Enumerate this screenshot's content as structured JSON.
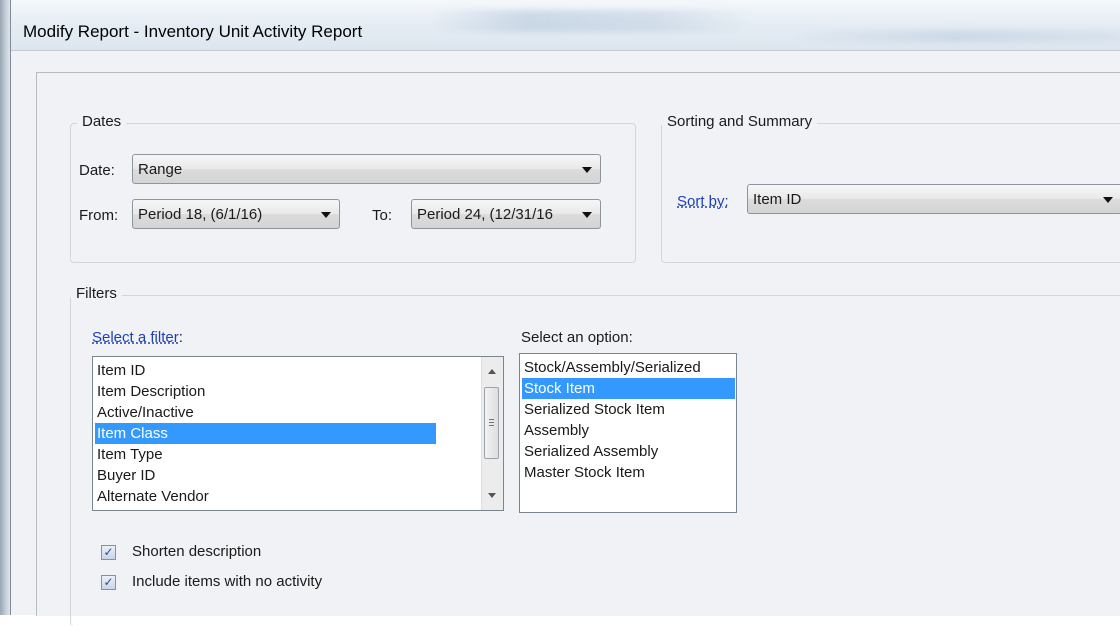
{
  "window": {
    "title": "Modify Report - Inventory Unit Activity Report"
  },
  "dates": {
    "group_title": "Dates",
    "date_label": "Date:",
    "date_value": "Range",
    "from_label": "From:",
    "from_value": "Period 18, (6/1/16)",
    "to_label": "To:",
    "to_value": "Period 24, (12/31/16"
  },
  "sorting": {
    "group_title": "Sorting and Summary",
    "sort_label": "Sort by:",
    "sort_value": "Item ID"
  },
  "filters": {
    "group_title": "Filters",
    "select_filter_label": "Select a filter",
    "select_filter_colon": ":",
    "filter_items": [
      "Item ID",
      "Item Description",
      "Active/Inactive",
      "Item Class",
      "Item Type",
      "Buyer ID",
      "Alternate Vendor"
    ],
    "selected_filter": "Item Class",
    "select_option_label": "Select an option:",
    "option_items": [
      "Stock/Assembly/Serialized",
      "Stock Item",
      "Serialized Stock Item",
      "Assembly",
      "Serialized Assembly",
      "Master Stock Item"
    ],
    "selected_option": "Stock Item"
  },
  "options": {
    "shorten_description": {
      "label": "Shorten description",
      "checked": true
    },
    "include_no_activity": {
      "label": "Include items with no activity",
      "checked": true
    }
  },
  "colors": {
    "selection": "#3399ff",
    "link": "#1f3fb4"
  }
}
